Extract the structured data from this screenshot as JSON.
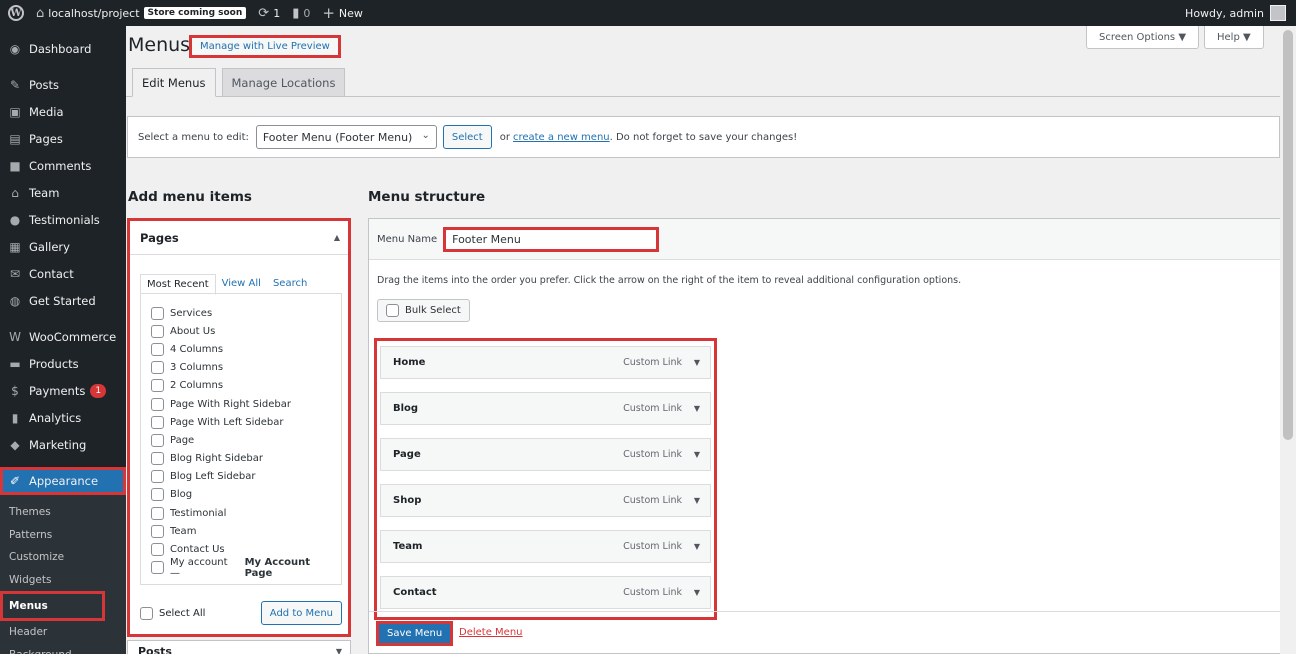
{
  "adminbar": {
    "site": "localhost/project",
    "store_badge": "Store coming soon",
    "updates": "1",
    "comments": "0",
    "new": "New",
    "howdy": "Howdy, admin"
  },
  "sidebar": {
    "items": [
      {
        "label": "Dashboard",
        "icon": "dashboard-icon",
        "glyph": "◉"
      },
      {
        "label": "Posts",
        "icon": "pin-icon",
        "glyph": "✎"
      },
      {
        "label": "Media",
        "icon": "media-icon",
        "glyph": "▣"
      },
      {
        "label": "Pages",
        "icon": "pages-icon",
        "glyph": "▤"
      },
      {
        "label": "Comments",
        "icon": "comments-icon",
        "glyph": "■"
      },
      {
        "label": "Team",
        "icon": "graduation-cap-icon",
        "glyph": "⌂"
      },
      {
        "label": "Testimonials",
        "icon": "users-icon",
        "glyph": "●"
      },
      {
        "label": "Gallery",
        "icon": "gallery-icon",
        "glyph": "▦"
      },
      {
        "label": "Contact",
        "icon": "envelope-icon",
        "glyph": "✉"
      },
      {
        "label": "Get Started",
        "icon": "globe-icon",
        "glyph": "◍"
      },
      {
        "label": "WooCommerce",
        "icon": "woo-icon",
        "glyph": "W"
      },
      {
        "label": "Products",
        "icon": "archive-icon",
        "glyph": "▬"
      },
      {
        "label": "Payments",
        "icon": "dollar-icon",
        "glyph": "$",
        "badge": "1"
      },
      {
        "label": "Analytics",
        "icon": "bar-chart-icon",
        "glyph": "▮"
      },
      {
        "label": "Marketing",
        "icon": "megaphone-icon",
        "glyph": "◆"
      },
      {
        "label": "Appearance",
        "icon": "paintbrush-icon",
        "glyph": "✐"
      }
    ],
    "submenu": [
      "Themes",
      "Patterns",
      "Customize",
      "Widgets",
      "Menus",
      "Header",
      "Background"
    ]
  },
  "page": {
    "title": "Menus",
    "live_preview": "Manage with Live Preview",
    "screen_options": "Screen Options ▼",
    "help": "Help ▼",
    "tabs": [
      "Edit Menus",
      "Manage Locations"
    ]
  },
  "manage": {
    "label": "Select a menu to edit:",
    "selected": "Footer Menu (Footer Menu)",
    "select_btn": "Select",
    "or": "or",
    "create_link": "create a new menu",
    "reminder": ". Do not forget to save your changes!"
  },
  "add_items": {
    "heading": "Add menu items",
    "box_title": "Pages",
    "tabs": [
      "Most Recent",
      "View All",
      "Search"
    ],
    "pages": [
      "Services",
      "About Us",
      "4 Columns",
      "3 Columns",
      "2 Columns",
      "Page With Right Sidebar",
      "Page With Left Sidebar",
      "Page",
      "Blog Right Sidebar",
      "Blog Left Sidebar",
      "Blog",
      "Testimonial",
      "Team",
      "Contact Us"
    ],
    "my_account": "My account —",
    "my_account_bold": "My Account Page",
    "select_all": "Select All",
    "add_btn": "Add to Menu",
    "posts_title": "Posts"
  },
  "structure": {
    "heading": "Menu structure",
    "name_label": "Menu Name",
    "name_value": "Footer Menu",
    "help": "Drag the items into the order you prefer. Click the arrow on the right of the item to reveal additional configuration options.",
    "bulk": "Bulk Select",
    "items": [
      {
        "title": "Home",
        "type": "Custom Link"
      },
      {
        "title": "Blog",
        "type": "Custom Link"
      },
      {
        "title": "Page",
        "type": "Custom Link"
      },
      {
        "title": "Shop",
        "type": "Custom Link"
      },
      {
        "title": "Team",
        "type": "Custom Link"
      },
      {
        "title": "Contact",
        "type": "Custom Link"
      }
    ],
    "save_btn": "Save Menu",
    "delete_link": "Delete Menu"
  }
}
